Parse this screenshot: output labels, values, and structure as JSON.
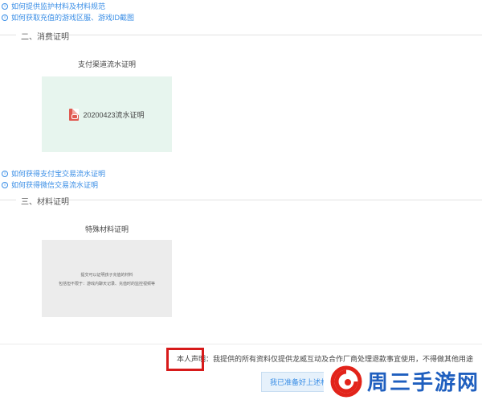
{
  "links_top": [
    "如何提供监护材料及材料规范",
    "如何获取充值的游戏区服、游戏ID截图"
  ],
  "section2": {
    "title": "二、消费证明",
    "card_title": "支付渠道流水证明",
    "file_name": "20200423流水证明"
  },
  "links_mid": [
    "如何获得支付宝交易流水证明",
    "如何获得微信交易流水证明"
  ],
  "section3": {
    "title": "三、材料证明",
    "card_title": "特殊材料证明",
    "card_line1": "提交可以证明孩子充值的材料",
    "card_line2": "包括但不限于：游戏内聊天记录、充值时的监控视频等"
  },
  "declaration": "本人声明：我提供的所有资料仅提供龙威互动及合作厂商处理退款事宜使用，不得做其他用途",
  "ready_button": "我已准备好上述材料",
  "watermark": {
    "text": "周三手游网"
  },
  "colors": {
    "link": "#3a8ee6",
    "highlight_box": "#d71a1a",
    "green_card": "#e7f5ee",
    "gray_card": "#ececec",
    "pdf_red": "#e05b52",
    "watermark_blue": "#1f5fbf",
    "watermark_red": "#e2231a"
  }
}
